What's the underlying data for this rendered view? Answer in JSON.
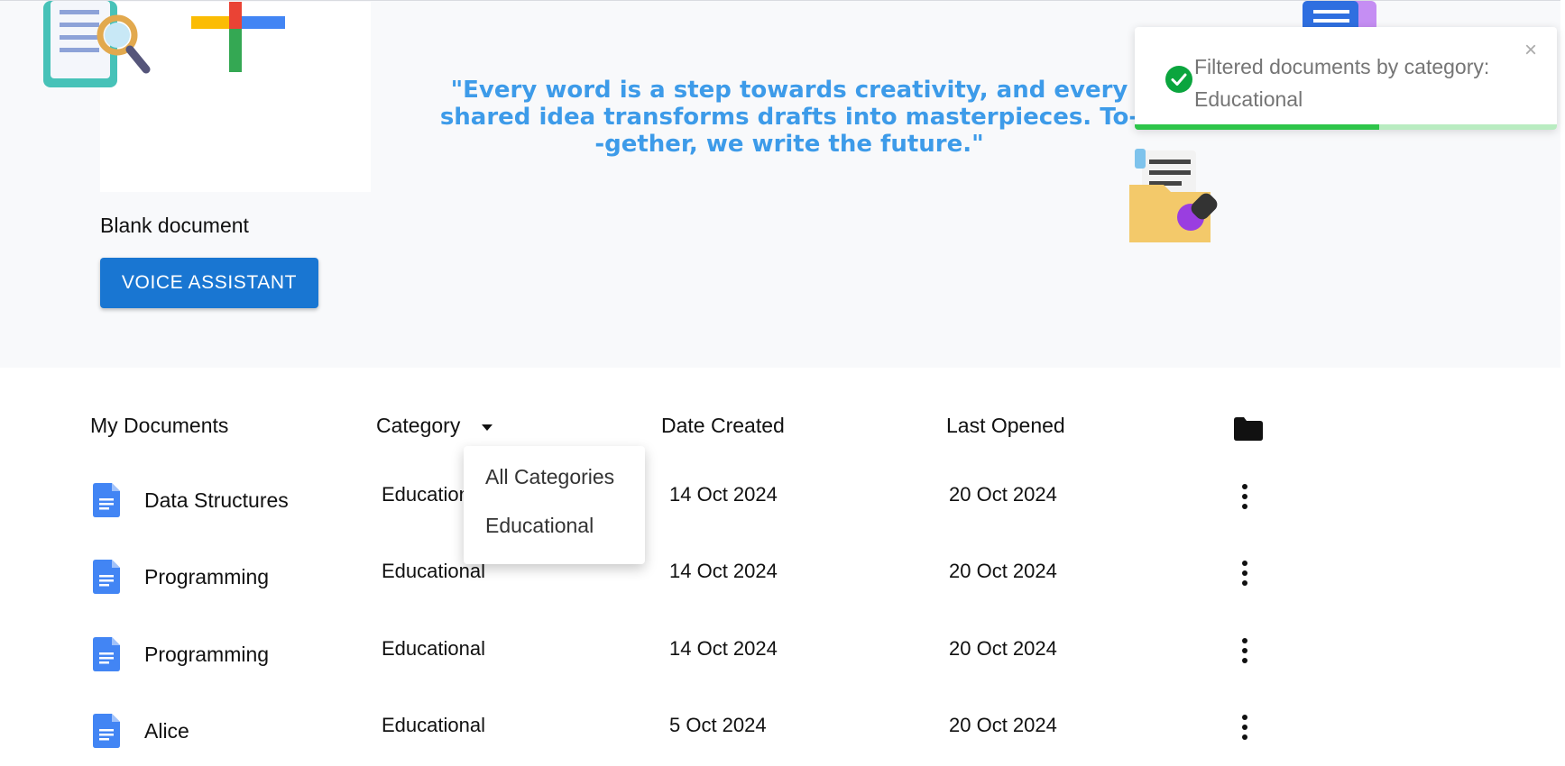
{
  "hero": {
    "blank_doc_label": "Blank document",
    "voice_button_label": "VOICE ASSISTANT",
    "quote": "\"Every word is a step towards creativity, and every\nshared idea transforms drafts into masterpieces. To-\n-gether, we write the future.\""
  },
  "toast": {
    "message": "Filtered documents by category: Educational",
    "close_label": "×",
    "progress": 0.58,
    "accent_color": "#2ec54a"
  },
  "table": {
    "headers": {
      "title": "My Documents",
      "category": "Category",
      "date_created": "Date Created",
      "last_opened": "Last Opened"
    },
    "rows": [
      {
        "title": "Data Structures",
        "category": "Educational",
        "date_created": "14 Oct 2024",
        "last_opened": "20 Oct 2024"
      },
      {
        "title": "Programming",
        "category": "Educational",
        "date_created": "14 Oct 2024",
        "last_opened": "20 Oct 2024"
      },
      {
        "title": "Programming",
        "category": "Educational",
        "date_created": "14 Oct 2024",
        "last_opened": "20 Oct 2024"
      },
      {
        "title": "Alice",
        "category": "Educational",
        "date_created": "5 Oct 2024",
        "last_opened": "20 Oct 2024"
      }
    ]
  },
  "category_dropdown": {
    "options": [
      "All Categories",
      "Educational"
    ]
  },
  "colors": {
    "primary": "#1976d2",
    "quote": "#3d9be9",
    "doc_icon": "#4285f4"
  }
}
